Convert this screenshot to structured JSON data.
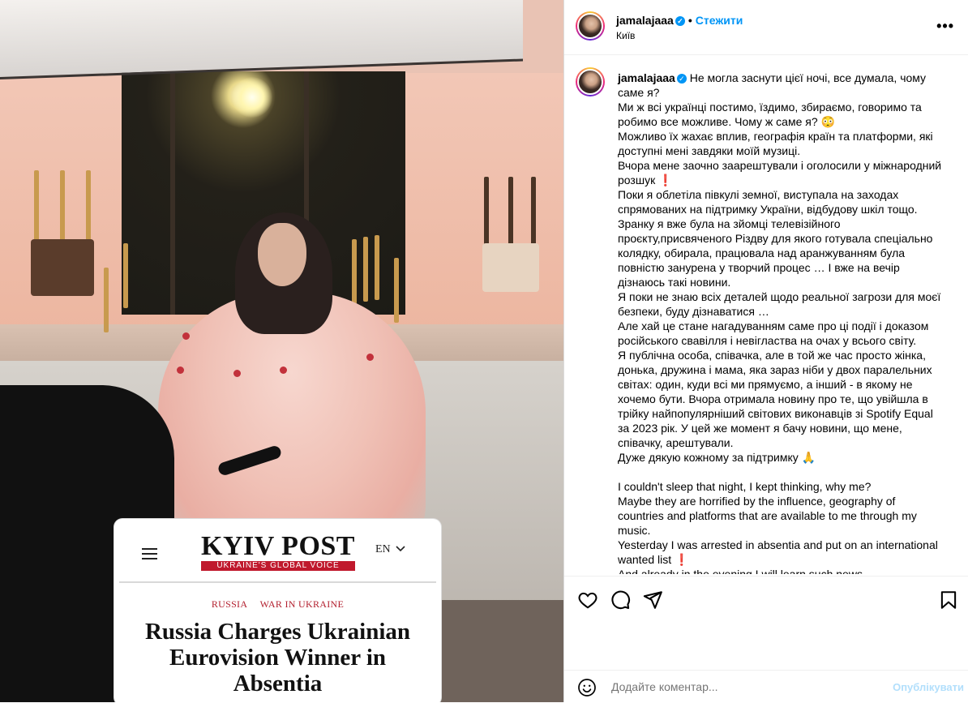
{
  "post": {
    "username": "jamalajaaa",
    "follow_label": "Стежити",
    "separator": "•",
    "location": "Київ",
    "more_label": "•••"
  },
  "article": {
    "logo_name": "KYIV POST",
    "logo_tagline": "UKRAINE'S GLOBAL VOICE",
    "lang": "EN",
    "tags": [
      "RUSSIA",
      "WAR IN UKRAINE"
    ],
    "headline": "Russia Charges Ukrainian Eurovision Winner in Absentia"
  },
  "caption": {
    "username": "jamalajaaa",
    "lines": [
      "Не могла заснути цієї ночі, все думала, чому саме я?",
      "Ми ж всі українці постимо, їздимо, збираємо, говоримо та робимо все можливе. Чому ж саме я? 😳",
      "Можливо їх жахає вплив, географія країн та платформи, які доступні мені завдяки моїй музиці.",
      "Вчора мене заочно заарештували і оголосили у міжнародний розшук ❗",
      "Поки я облетіла півкулі земної, виступала на заходах спрямованих на підтримку України, відбудову шкіл тощо.",
      "Зранку я вже була на зйомці телевізійного проєкту,присвяченого Різдву для якого готувала спеціально колядку, обирала, працювала над аранжуванням була повністю занурена у творчий процес … І вже на вечір дізнаюсь такі новини.",
      "Я поки не знаю всіх деталей щодо реальної загрози для моєї безпеки, буду дізнаватися …",
      "Але хай це стане нагадуванням саме про ці події і доказом російського свавілля і невігластва на очах у всього світу.",
      "Я публічна особа, співачка, але в той же час просто жінка, донька, дружина і мама, яка зараз ніби у двох паралельних світах: один, куди всі ми прямуємо, а інший - в якому не хочемо бути. Вчора отримала новину про те, що увійшла в трійку найпопулярніший світових виконавців зі Spotify Equal за 2023 рік. У цей же момент я бачу новини, що мене, співачку, арештували.",
      "Дуже дякую кожному за підтримку 🙏"
    ],
    "lines_en": [
      "I couldn't sleep that night, I kept thinking, why me?",
      "Maybe they are horrified by the influence, geography of countries and platforms that are available to me through my music.",
      "Yesterday I was arrested in absentia and put on an international wanted list ❗",
      "And already in the evening I will learn such news."
    ]
  },
  "comment": {
    "placeholder": "Додайте коментар...",
    "publish_label": "Опублікувати"
  },
  "colors": {
    "accent": "#0095f6",
    "publish_disabled": "#b2dffc",
    "kyivpost_red": "#c0192d"
  },
  "icons": [
    "heart-icon",
    "comment-icon",
    "share-icon",
    "bookmark-icon",
    "emoji-icon",
    "verified-icon",
    "more-icon",
    "hamburger-icon",
    "chevron-down-icon"
  ]
}
